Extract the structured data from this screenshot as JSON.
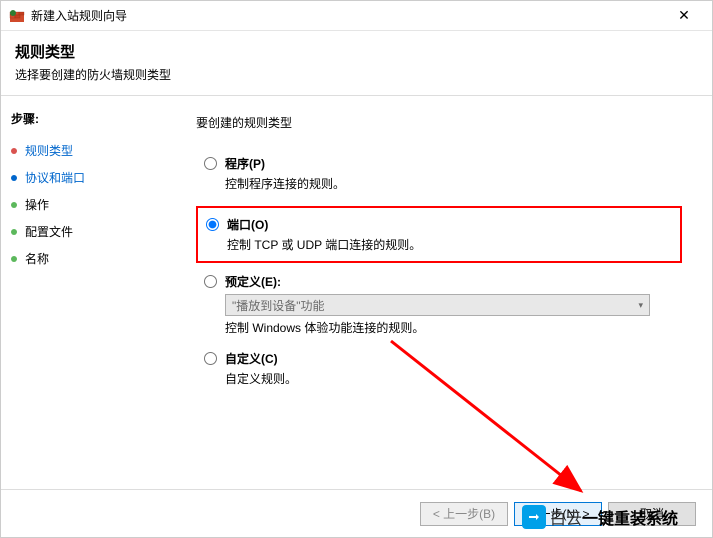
{
  "window": {
    "title": "新建入站规则向导",
    "close": "✕"
  },
  "header": {
    "title": "规则类型",
    "subtitle": "选择要创建的防火墙规则类型"
  },
  "sidebar": {
    "title": "步骤:",
    "items": [
      {
        "label": "规则类型",
        "state": "active"
      },
      {
        "label": "协议和端口",
        "state": "current"
      },
      {
        "label": "操作",
        "state": "pending"
      },
      {
        "label": "配置文件",
        "state": "pending"
      },
      {
        "label": "名称",
        "state": "pending"
      }
    ]
  },
  "main": {
    "question": "要创建的规则类型",
    "options": [
      {
        "key": "program",
        "label": "程序(P)",
        "desc": "控制程序连接的规则。",
        "selected": false,
        "highlight": false
      },
      {
        "key": "port",
        "label": "端口(O)",
        "desc": "控制 TCP 或 UDP 端口连接的规则。",
        "selected": true,
        "highlight": true
      },
      {
        "key": "predefined",
        "label": "预定义(E):",
        "desc": "控制 Windows 体验功能连接的规则。",
        "selected": false,
        "highlight": false,
        "dropdown_value": "\"播放到设备\"功能"
      },
      {
        "key": "custom",
        "label": "自定义(C)",
        "desc": "自定义规则。",
        "selected": false,
        "highlight": false
      }
    ]
  },
  "footer": {
    "back": "< 上一步(B)",
    "next": "下一步(N) >",
    "cancel": "取消"
  },
  "watermark": {
    "text": "白云一键重装系统"
  }
}
